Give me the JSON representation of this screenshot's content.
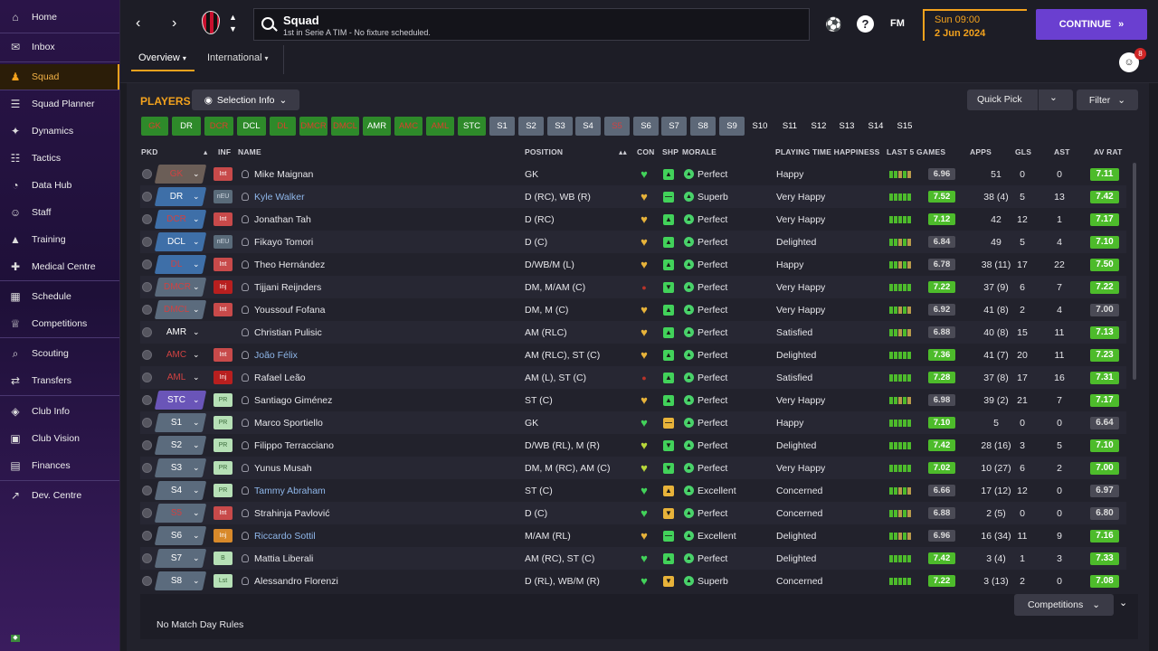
{
  "sidebar": {
    "items": [
      {
        "label": "Home",
        "icon": "home-icon"
      },
      {
        "label": "Inbox",
        "icon": "inbox-icon"
      },
      {
        "label": "Squad",
        "icon": "squad-icon",
        "active": true
      },
      {
        "label": "Squad Planner",
        "icon": "squad-planner-icon"
      },
      {
        "label": "Dynamics",
        "icon": "dynamics-icon"
      },
      {
        "label": "Tactics",
        "icon": "tactics-icon"
      },
      {
        "label": "Data Hub",
        "icon": "data-hub-icon"
      },
      {
        "label": "Staff",
        "icon": "staff-icon"
      },
      {
        "label": "Training",
        "icon": "training-icon"
      },
      {
        "label": "Medical Centre",
        "icon": "medical-icon"
      },
      {
        "label": "Schedule",
        "icon": "schedule-icon"
      },
      {
        "label": "Competitions",
        "icon": "trophy-icon"
      },
      {
        "label": "Scouting",
        "icon": "scouting-icon"
      },
      {
        "label": "Transfers",
        "icon": "transfers-icon"
      },
      {
        "label": "Club Info",
        "icon": "shield-icon"
      },
      {
        "label": "Club Vision",
        "icon": "briefcase-icon"
      },
      {
        "label": "Finances",
        "icon": "finances-icon"
      },
      {
        "label": "Dev. Centre",
        "icon": "dev-centre-icon"
      }
    ]
  },
  "header": {
    "title": "Squad",
    "subtitle": "1st in Serie A TIM - No fixture scheduled.",
    "fm_label": "FM",
    "date_time": "Sun 09:00",
    "date_day": "2 Jun 2024",
    "continue_label": "CONTINUE",
    "notification_count": "8"
  },
  "tabs": [
    {
      "label": "Overview",
      "active": true
    },
    {
      "label": "International",
      "active": false
    }
  ],
  "players_title": "PLAYERS",
  "selection_info_label": "Selection Info",
  "quick_pick_label": "Quick Pick",
  "filter_label": "Filter",
  "position_chips": [
    {
      "label": "GK",
      "style": "green-red"
    },
    {
      "label": "DR",
      "style": "green"
    },
    {
      "label": "DCR",
      "style": "green-red"
    },
    {
      "label": "DCL",
      "style": "green"
    },
    {
      "label": "DL",
      "style": "green-red"
    },
    {
      "label": "DMCR",
      "style": "green-red"
    },
    {
      "label": "DMCL",
      "style": "green-red"
    },
    {
      "label": "AMR",
      "style": "green"
    },
    {
      "label": "AMC",
      "style": "green-red"
    },
    {
      "label": "AML",
      "style": "green-red"
    },
    {
      "label": "STC",
      "style": "green"
    },
    {
      "label": "S1",
      "style": "grey"
    },
    {
      "label": "S2",
      "style": "grey"
    },
    {
      "label": "S3",
      "style": "grey"
    },
    {
      "label": "S4",
      "style": "grey"
    },
    {
      "label": "S5",
      "style": "grey-red"
    },
    {
      "label": "S6",
      "style": "grey"
    },
    {
      "label": "S7",
      "style": "grey"
    },
    {
      "label": "S8",
      "style": "grey"
    },
    {
      "label": "S9",
      "style": "grey"
    },
    {
      "label": "S10",
      "style": "none"
    },
    {
      "label": "S11",
      "style": "none"
    },
    {
      "label": "S12",
      "style": "none"
    },
    {
      "label": "S13",
      "style": "none"
    },
    {
      "label": "S14",
      "style": "none"
    },
    {
      "label": "S15",
      "style": "none"
    }
  ],
  "columns": {
    "pkd": "PKD",
    "inf": "INF",
    "name": "NAME",
    "position": "POSITION",
    "con": "CON",
    "shp": "SHP",
    "morale": "MORALE",
    "pth": "PLAYING TIME HAPPINESS",
    "last5": "LAST 5 GAMES",
    "apps": "APPS",
    "gls": "GLS",
    "ast": "AST",
    "avrat": "AV RAT"
  },
  "players": [
    {
      "pkd": "GK",
      "pkd_style": "green-red",
      "inf": "Int",
      "inf_style": "int",
      "name": "Mike Maignan",
      "link": false,
      "position": "GK",
      "con": "green",
      "shp": "up-green",
      "morale": "Perfect",
      "pth": "Happy",
      "form": "6.96",
      "form_good": false,
      "apps": "51",
      "gls": "0",
      "ast": "0",
      "avrat": "7.11",
      "av_good": true
    },
    {
      "pkd": "DR",
      "pkd_style": "blue",
      "inf": "nEU",
      "inf_style": "neu",
      "name": "Kyle Walker",
      "link": true,
      "position": "D (RC), WB (R)",
      "con": "gold",
      "shp": "flat-green",
      "morale": "Superb",
      "pth": "Very Happy",
      "form": "7.52",
      "form_good": true,
      "apps": "38 (4)",
      "gls": "5",
      "ast": "13",
      "avrat": "7.42",
      "av_good": true
    },
    {
      "pkd": "DCR",
      "pkd_style": "blue-red",
      "inf": "Int",
      "inf_style": "int",
      "name": "Jonathan Tah",
      "link": false,
      "position": "D (RC)",
      "con": "gold",
      "shp": "up-green",
      "morale": "Perfect",
      "pth": "Very Happy",
      "form": "7.12",
      "form_good": true,
      "apps": "42",
      "gls": "12",
      "ast": "1",
      "avrat": "7.17",
      "av_good": true
    },
    {
      "pkd": "DCL",
      "pkd_style": "blue",
      "inf": "nEU",
      "inf_style": "neu",
      "name": "Fikayo Tomori",
      "link": false,
      "position": "D (C)",
      "con": "gold",
      "shp": "up-green",
      "morale": "Perfect",
      "pth": "Delighted",
      "form": "6.84",
      "form_good": false,
      "apps": "49",
      "gls": "5",
      "ast": "4",
      "avrat": "7.10",
      "av_good": true
    },
    {
      "pkd": "DL",
      "pkd_style": "blue-red",
      "inf": "Int",
      "inf_style": "int",
      "name": "Theo Hernández",
      "link": false,
      "position": "D/WB/M (L)",
      "con": "gold",
      "shp": "up-green",
      "morale": "Perfect",
      "pth": "Happy",
      "form": "6.78",
      "form_good": false,
      "apps": "38 (11)",
      "gls": "17",
      "ast": "22",
      "avrat": "7.50",
      "av_good": true
    },
    {
      "pkd": "DMCR",
      "pkd_style": "grey-red",
      "inf": "Inj",
      "inf_style": "inj",
      "name": "Tijjani Reijnders",
      "link": false,
      "position": "DM, M/AM (C)",
      "con": "red-dot",
      "shp": "down-green",
      "morale": "Perfect",
      "pth": "Very Happy",
      "form": "7.22",
      "form_good": true,
      "apps": "37 (9)",
      "gls": "6",
      "ast": "7",
      "avrat": "7.22",
      "av_good": true
    },
    {
      "pkd": "DMCL",
      "pkd_style": "grey-red",
      "inf": "Int",
      "inf_style": "int",
      "name": "Youssouf Fofana",
      "link": false,
      "position": "DM, M (C)",
      "con": "gold",
      "shp": "up-green",
      "morale": "Perfect",
      "pth": "Very Happy",
      "form": "6.92",
      "form_good": false,
      "apps": "41 (8)",
      "gls": "2",
      "ast": "4",
      "avrat": "7.00",
      "av_good": false
    },
    {
      "pkd": "AMR",
      "pkd_style": "none",
      "inf": "",
      "inf_style": "none",
      "name": "Christian Pulisic",
      "link": false,
      "position": "AM (RLC)",
      "con": "gold",
      "shp": "up-green",
      "morale": "Perfect",
      "pth": "Satisfied",
      "form": "6.88",
      "form_good": false,
      "apps": "40 (8)",
      "gls": "15",
      "ast": "11",
      "avrat": "7.13",
      "av_good": true
    },
    {
      "pkd": "AMC",
      "pkd_style": "none-red",
      "inf": "Int",
      "inf_style": "int",
      "name": "João Félix",
      "link": true,
      "position": "AM (RLC), ST (C)",
      "con": "gold",
      "shp": "up-green",
      "morale": "Perfect",
      "pth": "Delighted",
      "form": "7.36",
      "form_good": true,
      "apps": "41 (7)",
      "gls": "20",
      "ast": "11",
      "avrat": "7.23",
      "av_good": true
    },
    {
      "pkd": "AML",
      "pkd_style": "none-red",
      "inf": "Inj",
      "inf_style": "inj",
      "name": "Rafael Leão",
      "link": false,
      "position": "AM (L), ST (C)",
      "con": "red-dot",
      "shp": "up-green",
      "morale": "Perfect",
      "pth": "Satisfied",
      "form": "7.28",
      "form_good": true,
      "apps": "37 (8)",
      "gls": "17",
      "ast": "16",
      "avrat": "7.31",
      "av_good": true
    },
    {
      "pkd": "STC",
      "pkd_style": "purple",
      "inf": "PR",
      "inf_style": "pr",
      "name": "Santiago Giménez",
      "link": false,
      "position": "ST (C)",
      "con": "gold",
      "shp": "up-green",
      "morale": "Perfect",
      "pth": "Very Happy",
      "form": "6.98",
      "form_good": false,
      "apps": "39 (2)",
      "gls": "21",
      "ast": "7",
      "avrat": "7.17",
      "av_good": true
    },
    {
      "pkd": "S1",
      "pkd_style": "grey",
      "inf": "PR",
      "inf_style": "pr",
      "name": "Marco Sportiello",
      "link": false,
      "position": "GK",
      "con": "green",
      "shp": "flat-yellow",
      "morale": "Perfect",
      "pth": "Happy",
      "form": "7.10",
      "form_good": true,
      "apps": "5",
      "gls": "0",
      "ast": "0",
      "avrat": "6.64",
      "av_good": false
    },
    {
      "pkd": "S2",
      "pkd_style": "grey",
      "inf": "PR",
      "inf_style": "pr",
      "name": "Filippo Terracciano",
      "link": false,
      "position": "D/WB (RL), M (R)",
      "con": "lime",
      "shp": "down-green",
      "morale": "Perfect",
      "pth": "Delighted",
      "form": "7.42",
      "form_good": true,
      "apps": "28 (16)",
      "gls": "3",
      "ast": "5",
      "avrat": "7.10",
      "av_good": true
    },
    {
      "pkd": "S3",
      "pkd_style": "grey",
      "inf": "PR",
      "inf_style": "pr",
      "name": "Yunus Musah",
      "link": false,
      "position": "DM, M (RC), AM (C)",
      "con": "lime",
      "shp": "down-green",
      "morale": "Perfect",
      "pth": "Very Happy",
      "form": "7.02",
      "form_good": true,
      "apps": "10 (27)",
      "gls": "6",
      "ast": "2",
      "avrat": "7.00",
      "av_good": true
    },
    {
      "pkd": "S4",
      "pkd_style": "grey",
      "inf": "PR",
      "inf_style": "pr",
      "name": "Tammy Abraham",
      "link": true,
      "position": "ST (C)",
      "con": "green",
      "shp": "up-yellow",
      "morale": "Excellent",
      "pth": "Concerned",
      "form": "6.66",
      "form_good": false,
      "apps": "17 (12)",
      "gls": "12",
      "ast": "0",
      "avrat": "6.97",
      "av_good": false
    },
    {
      "pkd": "S5",
      "pkd_style": "grey-red",
      "inf": "Int",
      "inf_style": "int",
      "name": "Strahinja Pavlović",
      "link": false,
      "position": "D (C)",
      "con": "green",
      "shp": "down-yellow",
      "morale": "Perfect",
      "pth": "Concerned",
      "form": "6.88",
      "form_good": false,
      "apps": "2 (5)",
      "gls": "0",
      "ast": "0",
      "avrat": "6.80",
      "av_good": false
    },
    {
      "pkd": "S6",
      "pkd_style": "grey",
      "inf": "Inj",
      "inf_style": "inj-orange",
      "name": "Riccardo Sottil",
      "link": true,
      "position": "M/AM (RL)",
      "con": "gold",
      "shp": "flat-green",
      "morale": "Excellent",
      "pth": "Delighted",
      "form": "6.96",
      "form_good": false,
      "apps": "16 (34)",
      "gls": "11",
      "ast": "9",
      "avrat": "7.16",
      "av_good": true
    },
    {
      "pkd": "S7",
      "pkd_style": "grey",
      "inf": "B",
      "inf_style": "b",
      "name": "Mattia Liberali",
      "link": false,
      "position": "AM (RC), ST (C)",
      "con": "green",
      "shp": "up-green",
      "morale": "Perfect",
      "pth": "Delighted",
      "form": "7.42",
      "form_good": true,
      "apps": "3 (4)",
      "gls": "1",
      "ast": "3",
      "avrat": "7.33",
      "av_good": true
    },
    {
      "pkd": "S8",
      "pkd_style": "grey",
      "inf": "Lst",
      "inf_style": "lst",
      "name": "Alessandro Florenzi",
      "link": false,
      "position": "D (RL), WB/M (R)",
      "con": "green",
      "shp": "down-yellow",
      "morale": "Superb",
      "pth": "Concerned",
      "form": "7.22",
      "form_good": true,
      "apps": "3 (13)",
      "gls": "2",
      "ast": "0",
      "avrat": "7.08",
      "av_good": true
    }
  ],
  "footer": {
    "match_day_rules": "No Match Day Rules",
    "competitions_label": "Competitions"
  }
}
